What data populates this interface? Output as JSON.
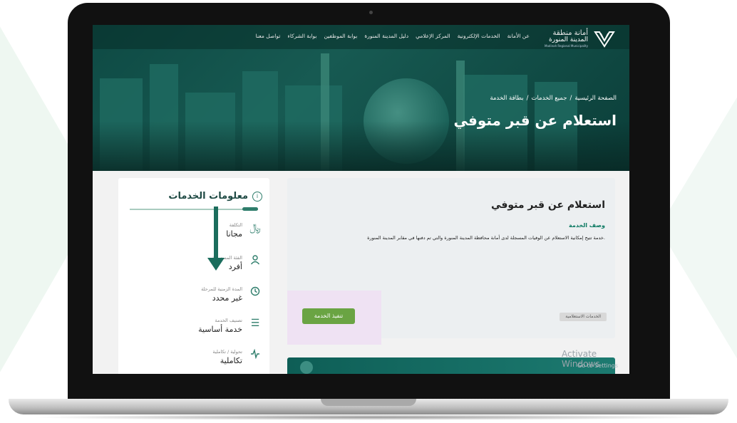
{
  "nav": {
    "logo_title": "أمانة منطقة",
    "logo_subtitle": "المدينة المنورة",
    "logo_en": "Madinah Regional Municipality",
    "items": [
      "عن الأمانة",
      "الخدمات الإلكترونية",
      "المركز الإعلامي",
      "دليل المدينة المنورة",
      "بوابة الموظفين",
      "بوابة الشركاء",
      "تواصل معنا"
    ]
  },
  "breadcrumb": {
    "home": "الصفحة الرئيسية",
    "sep1": "/",
    "services": "جميع الخدمات",
    "sep2": "/",
    "current": "بطاقة الخدمة"
  },
  "hero_title": "استعلام عن قبر متوفي",
  "info_panel": {
    "title": "معلومات الخدمات",
    "rows": [
      {
        "label": "التكلفة",
        "value": "مجانا",
        "icon": "riyal-icon"
      },
      {
        "label": "الفئة المستهدفة",
        "value": "أفرد",
        "icon": "user-icon"
      },
      {
        "label": "المدة الزمنية للمرحلة",
        "value": "غير محدد",
        "icon": "clock-icon"
      },
      {
        "label": "تصنيف الخدمة",
        "value": "خدمة أساسية",
        "icon": "list-icon"
      },
      {
        "label": "تحولية / تكاملية",
        "value": "تكاملية",
        "icon": "pulse-icon"
      }
    ]
  },
  "service_card": {
    "title": "استعلام عن قبر متوفي",
    "desc_label": "وصف الخدمة",
    "desc_text": "خدمة تتيح إمكانية الاستعلام عن الوفيات المسجلة لدى أمانة محافظة المدينة المنورة والتي تم دفنها في مقابر المدينة المنورة.",
    "execute_button": "تنفيذ الخدمة",
    "tag": "الخدمات الاستعلامية"
  },
  "watermark": {
    "line1": "Activate Windows",
    "line2": "Go to Settings"
  },
  "colors": {
    "primary": "#0e5e56",
    "button": "#6aa443",
    "highlight": "#efe2f3"
  }
}
